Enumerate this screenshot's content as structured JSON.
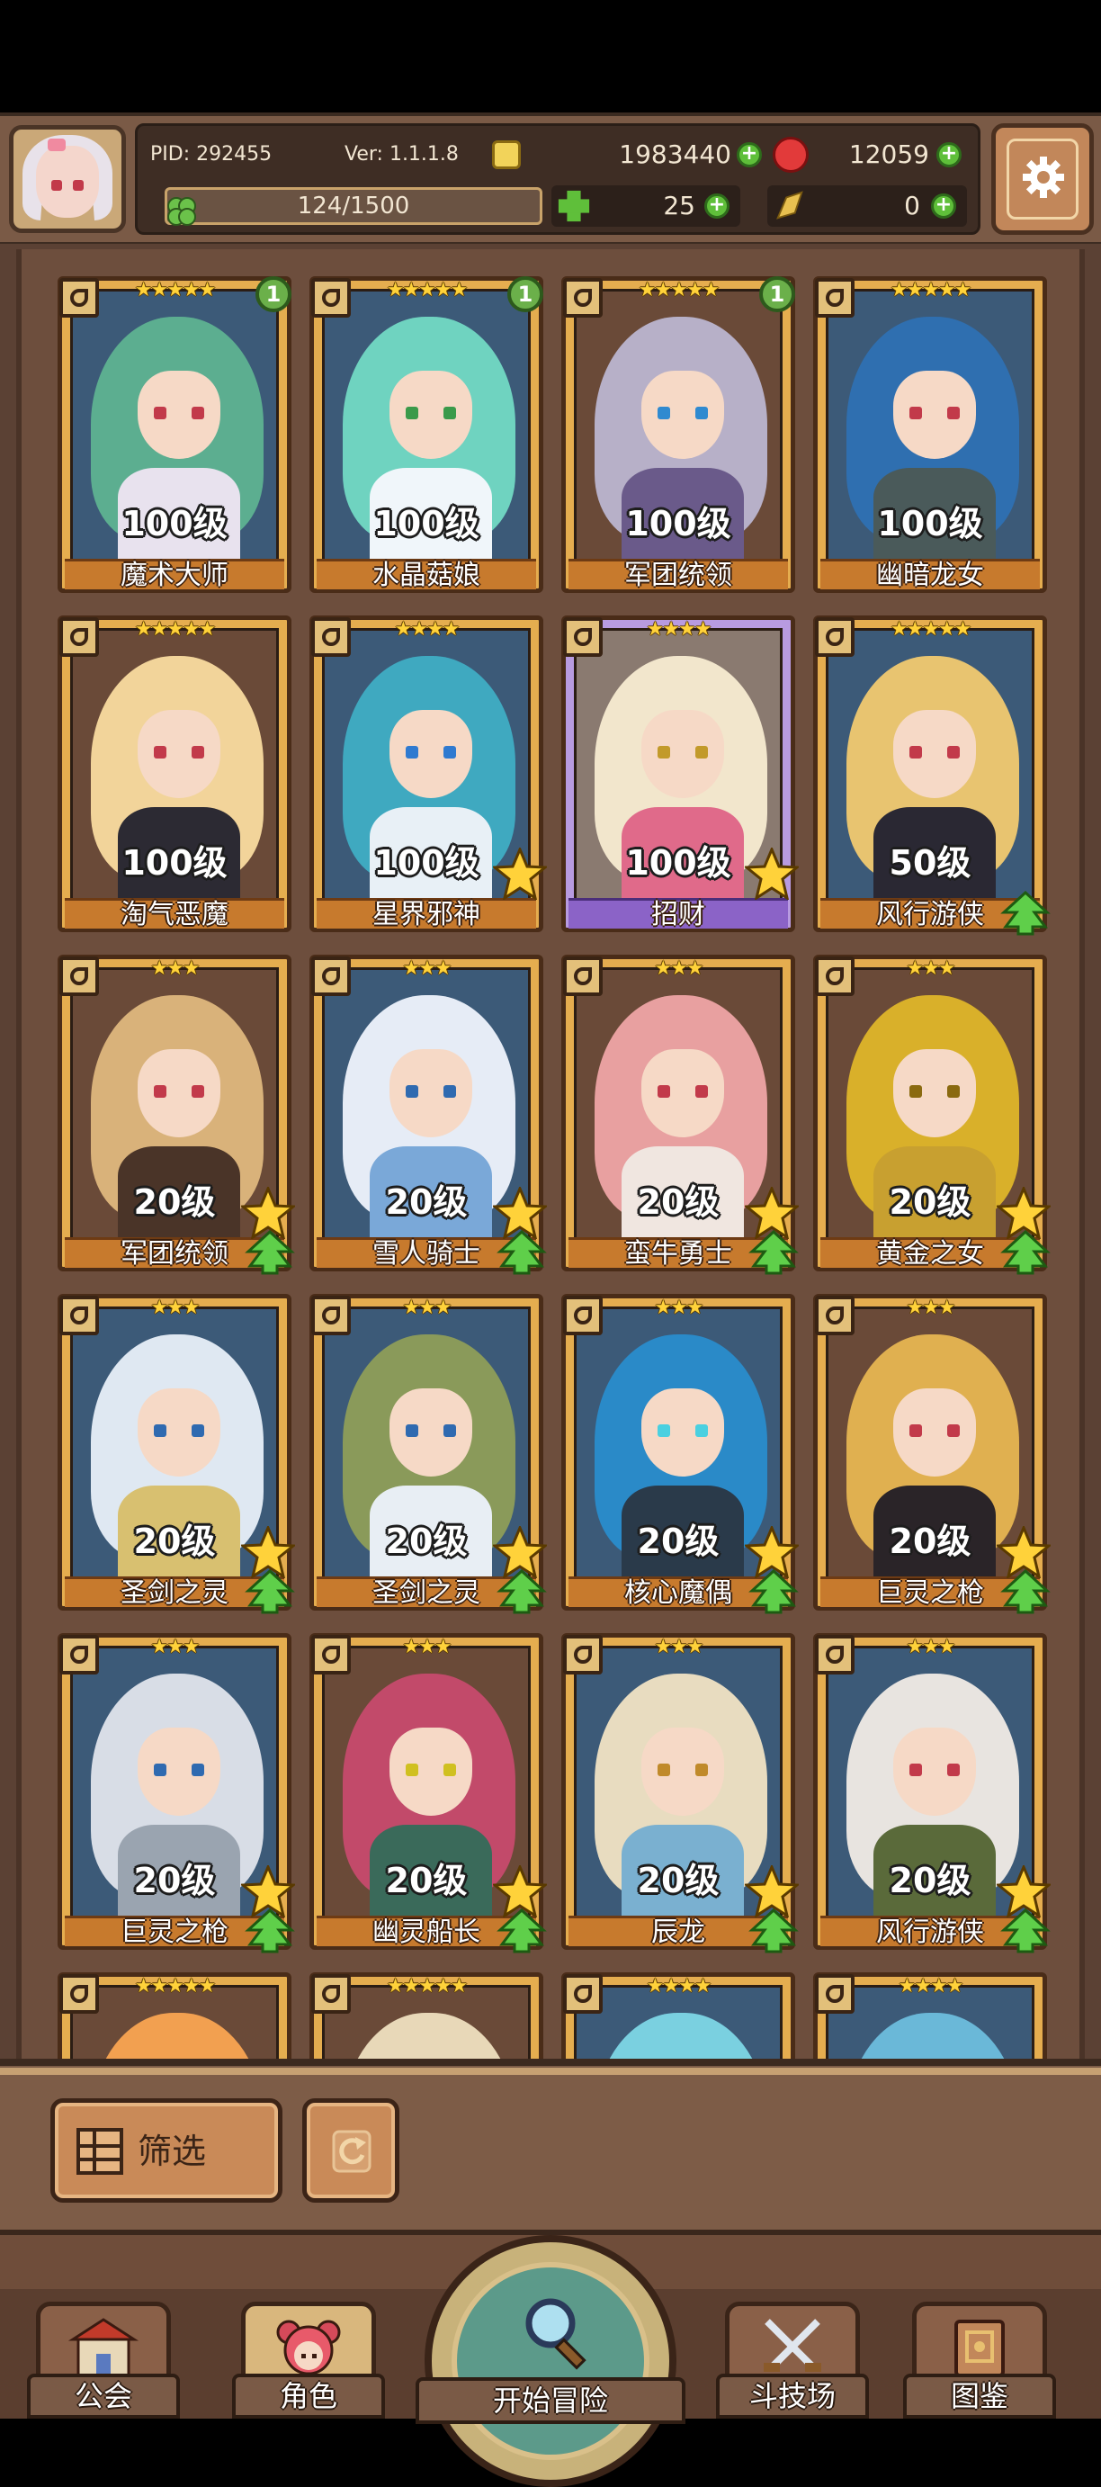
{
  "header": {
    "pid_text": "PID: 292455",
    "version_text": "Ver: 1.1.1.8",
    "gold": "1983440",
    "gems": "12059",
    "exp_text": "124/1500",
    "clover": "25",
    "shard": "0"
  },
  "heroes": [
    {
      "name": "魔术大师",
      "level": "100级",
      "stars": "★★★★★",
      "badge": "1",
      "theme": "blue",
      "hair": "#5cae90",
      "eye": "#c23a4a",
      "body": "#e8e2ee",
      "rank_up": false,
      "star_ready": false
    },
    {
      "name": "水晶菇娘",
      "level": "100级",
      "stars": "★★★★★",
      "badge": "1",
      "theme": "blue",
      "hair": "#6fd3c0",
      "eye": "#3a9a4a",
      "body": "#f0f6fa",
      "rank_up": false,
      "star_ready": false
    },
    {
      "name": "军团统领",
      "level": "100级",
      "stars": "★★★★★",
      "badge": "1",
      "theme": "brown",
      "hair": "#b7b0c8",
      "eye": "#2f8ad0",
      "body": "#6a5a8a",
      "rank_up": false,
      "star_ready": false
    },
    {
      "name": "幽暗龙女",
      "level": "100级",
      "stars": "★★★★★",
      "badge": "",
      "theme": "blue",
      "hair": "#2f6fb0",
      "eye": "#c23a4a",
      "body": "#4a5a5a",
      "rank_up": false,
      "star_ready": false
    },
    {
      "name": "淘气恶魔",
      "level": "100级",
      "stars": "★★★★★",
      "badge": "",
      "theme": "brown",
      "hair": "#f2d49a",
      "eye": "#c23a4a",
      "body": "#2c2a33",
      "rank_up": false,
      "star_ready": false
    },
    {
      "name": "星界邪神",
      "level": "100级",
      "stars": "★★★★",
      "badge": "",
      "theme": "blue",
      "hair": "#3fa9c0",
      "eye": "#2f7ad0",
      "body": "#e8f0f6",
      "rank_up": false,
      "star_ready": true
    },
    {
      "name": "招财",
      "level": "100级",
      "stars": "★★★★",
      "badge": "",
      "theme": "purple",
      "hair": "#f2e6cc",
      "eye": "#c29a2a",
      "body": "#e06a8a",
      "rank_up": false,
      "star_ready": true
    },
    {
      "name": "风行游侠",
      "level": "50级",
      "stars": "★★★★★",
      "badge": "",
      "theme": "blue",
      "hair": "#e8c470",
      "eye": "#c23a4a",
      "body": "#2a2833",
      "rank_up": true,
      "star_ready": false
    },
    {
      "name": "军团统领",
      "level": "20级",
      "stars": "★★★",
      "badge": "",
      "theme": "brown",
      "hair": "#d9b27a",
      "eye": "#c23a4a",
      "body": "#4a3428",
      "rank_up": true,
      "star_ready": true
    },
    {
      "name": "雪人骑士",
      "level": "20级",
      "stars": "★★★",
      "badge": "",
      "theme": "blue",
      "hair": "#e6ecf6",
      "eye": "#2f6ab0",
      "body": "#7aa8d8",
      "rank_up": true,
      "star_ready": true
    },
    {
      "name": "蛮牛勇士",
      "level": "20级",
      "stars": "★★★",
      "badge": "",
      "theme": "brown",
      "hair": "#e8a0a0",
      "eye": "#c23a4a",
      "body": "#f0e6e0",
      "rank_up": true,
      "star_ready": true
    },
    {
      "name": "黄金之女",
      "level": "20级",
      "stars": "★★★",
      "badge": "",
      "theme": "brown",
      "hair": "#d9b02a",
      "eye": "#8a6a10",
      "body": "#c8a030",
      "rank_up": true,
      "star_ready": true
    },
    {
      "name": "圣剑之灵",
      "level": "20级",
      "stars": "★★★",
      "badge": "",
      "theme": "blue",
      "hair": "#dfe8f2",
      "eye": "#2f6ab0",
      "body": "#d8c070",
      "rank_up": true,
      "star_ready": true
    },
    {
      "name": "圣剑之灵",
      "level": "20级",
      "stars": "★★★",
      "badge": "",
      "theme": "blue",
      "hair": "#8a9a5a",
      "eye": "#2f6ab0",
      "body": "#e8eef4",
      "rank_up": true,
      "star_ready": true
    },
    {
      "name": "核心魔偶",
      "level": "20级",
      "stars": "★★★",
      "badge": "",
      "theme": "blue",
      "hair": "#2a8ac8",
      "eye": "#4ad0e0",
      "body": "#2a3a4a",
      "rank_up": true,
      "star_ready": true
    },
    {
      "name": "巨灵之枪",
      "level": "20级",
      "stars": "★★★",
      "badge": "",
      "theme": "brown",
      "hair": "#e0b050",
      "eye": "#c23a4a",
      "body": "#2a2428",
      "rank_up": true,
      "star_ready": true
    },
    {
      "name": "巨灵之枪",
      "level": "20级",
      "stars": "★★★",
      "badge": "",
      "theme": "blue",
      "hair": "#d8dde6",
      "eye": "#2f6ab0",
      "body": "#9aa4b0",
      "rank_up": true,
      "star_ready": true
    },
    {
      "name": "幽灵船长",
      "level": "20级",
      "stars": "★★★",
      "badge": "",
      "theme": "brown",
      "hair": "#c24a6a",
      "eye": "#d0c020",
      "body": "#3a6a5a",
      "rank_up": true,
      "star_ready": true
    },
    {
      "name": "辰龙",
      "level": "20级",
      "stars": "★★★",
      "badge": "",
      "theme": "blue",
      "hair": "#e8dcc0",
      "eye": "#c08a2a",
      "body": "#7ab0d0",
      "rank_up": true,
      "star_ready": true
    },
    {
      "name": "风行游侠",
      "level": "20级",
      "stars": "★★★",
      "badge": "",
      "theme": "blue",
      "hair": "#e8e4e0",
      "eye": "#c23a4a",
      "body": "#5a6a3a",
      "rank_up": true,
      "star_ready": true
    }
  ],
  "partial_heroes": [
    {
      "stars": "★★★★★",
      "hair": "#f2a050",
      "theme": "brown"
    },
    {
      "stars": "★★★★★",
      "hair": "#e8d8b8",
      "theme": "brown"
    },
    {
      "stars": "★★★★",
      "hair": "#7ad0e0",
      "theme": "blue"
    },
    {
      "stars": "★★★★",
      "hair": "#6ab8d8",
      "theme": "blue"
    }
  ],
  "actions": {
    "filter_label": "筛选"
  },
  "nav": {
    "guild": "公会",
    "character": "角色",
    "adventure": "开始冒险",
    "arena": "斗技场",
    "codex": "图鉴"
  },
  "colors": {
    "plus_green": "#5fbf3a",
    "card_gold": "#e5ad4f",
    "card_purple": "#b89be0",
    "star_yellow": "#ffd23a"
  }
}
